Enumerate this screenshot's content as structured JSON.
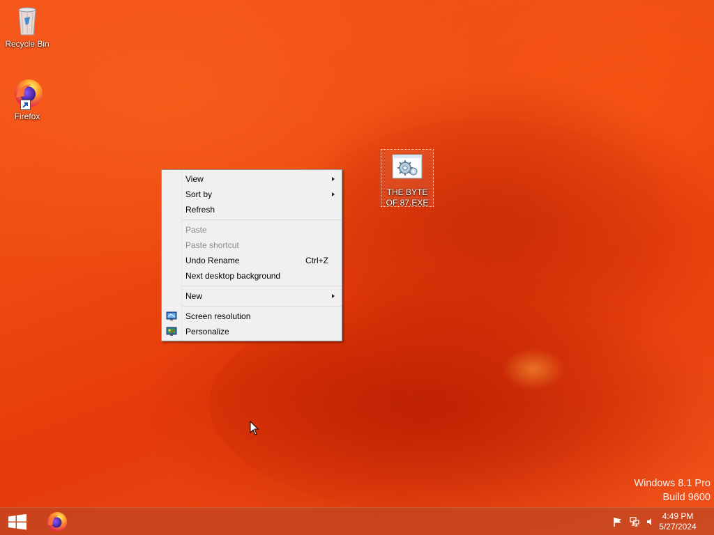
{
  "desktop": {
    "icons": [
      {
        "label": "Recycle Bin"
      },
      {
        "label": "Firefox"
      },
      {
        "label": "THE BYTE OF 87.EXE"
      }
    ],
    "watermark": {
      "line1": "Windows 8.1 Pro",
      "line2": "Build 9600"
    }
  },
  "context_menu": {
    "items": [
      {
        "label": "View",
        "has_submenu": true
      },
      {
        "label": "Sort by",
        "has_submenu": true
      },
      {
        "label": "Refresh"
      },
      {
        "label": "Paste",
        "disabled": true
      },
      {
        "label": "Paste shortcut",
        "disabled": true
      },
      {
        "label": "Undo Rename",
        "shortcut": "Ctrl+Z"
      },
      {
        "label": "Next desktop background"
      },
      {
        "label": "New",
        "has_submenu": true
      },
      {
        "label": "Screen resolution",
        "icon": "screen-resolution-icon"
      },
      {
        "label": "Personalize",
        "icon": "personalize-icon"
      }
    ]
  },
  "taskbar": {
    "pinned": [
      "start-button",
      "firefox"
    ],
    "tray_icons": [
      "action-center-flag-icon",
      "network-icon",
      "volume-muted-icon"
    ],
    "clock": {
      "time": "4:49 PM",
      "date": "5/27/2024"
    }
  },
  "colors": {
    "wallpaper": "#ee4a10",
    "menu_bg": "#f0f0f0",
    "disabled_text": "#8d8d8d"
  }
}
